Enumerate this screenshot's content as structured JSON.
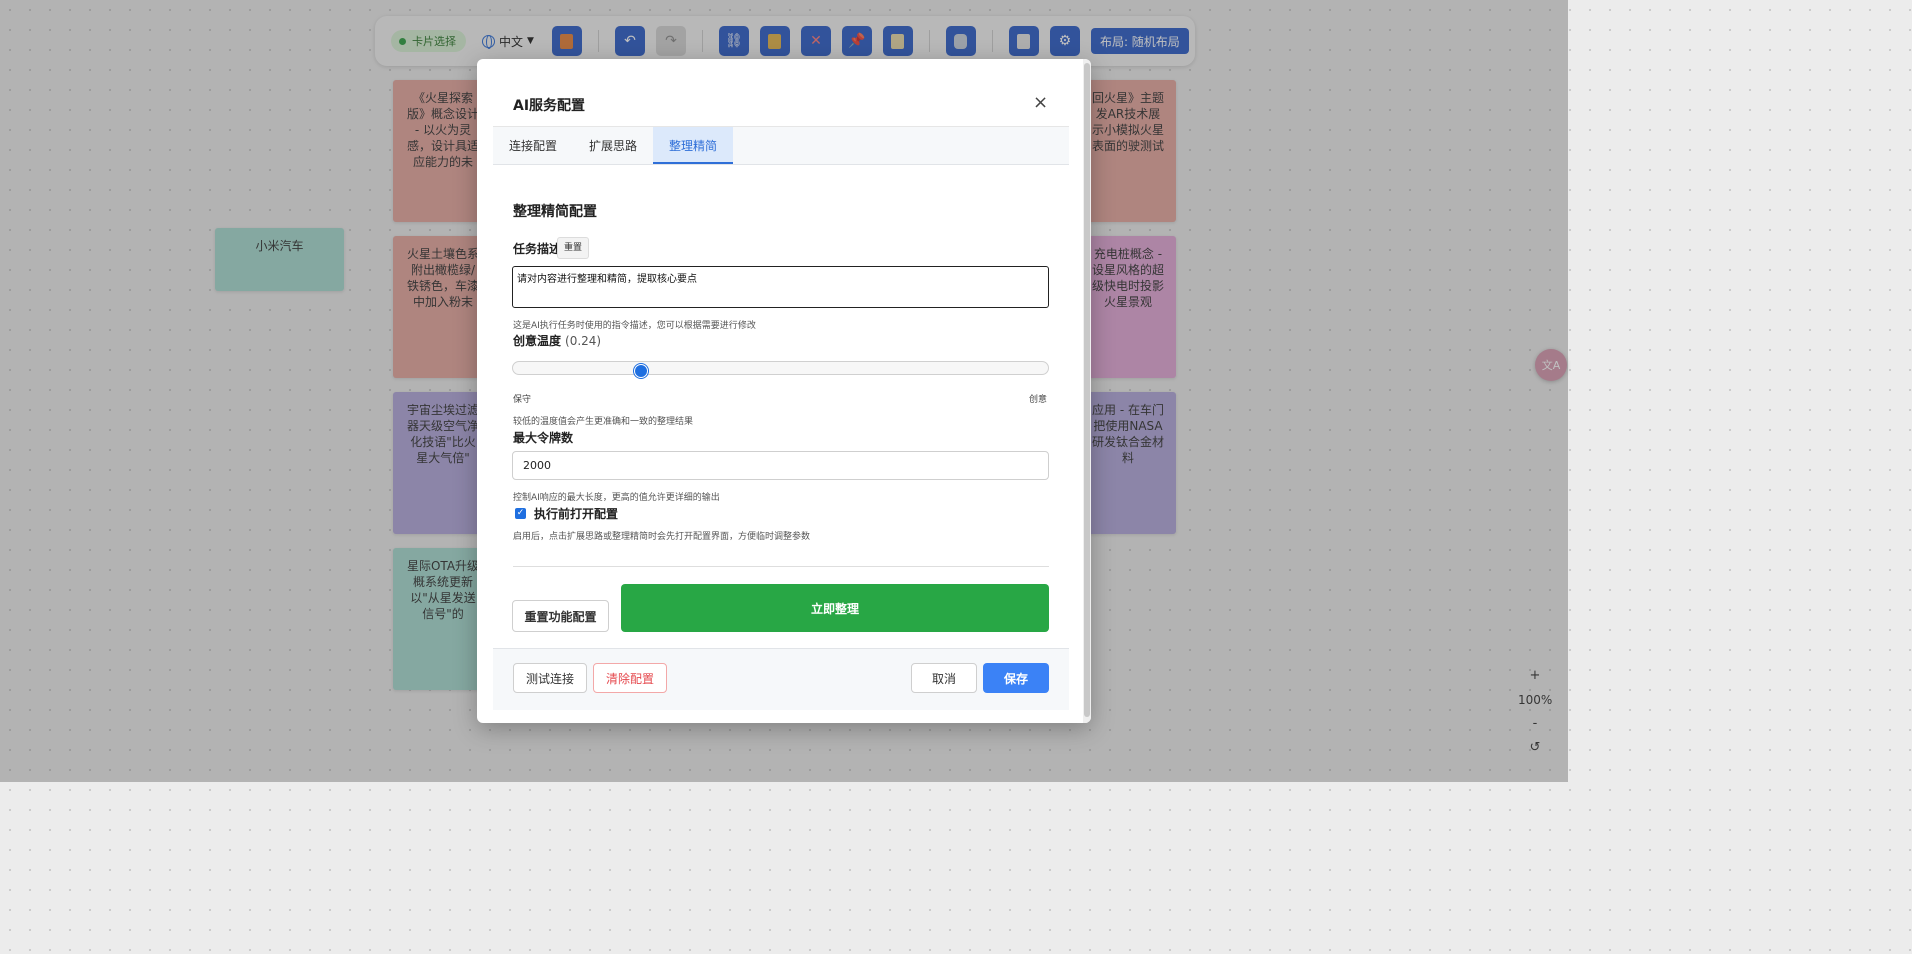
{
  "toolbar": {
    "mode_badge": "卡片选择",
    "language": "中文",
    "layout_button": "布局: 随机布局"
  },
  "cards": [
    {
      "text": "《火星探索版》概念设计 - 以火为灵感，设计具适应能力的未",
      "color": "#e6a8a0"
    },
    {
      "text": "小米汽车",
      "color": "#a8dcd2"
    },
    {
      "text": "火星土壤色系附出橄榄绿/铁锈色，车漆中加入粉末",
      "color": "#e6a8a0"
    },
    {
      "text": "宇宙尘埃过滤器天级空气净化技语\"比火星大气倍\"",
      "color": "#b3a9dc"
    },
    {
      "text": "星际OTA升级概系统更新以\"从星发送信号\"的",
      "color": "#a8dcd2"
    },
    {
      "text": "回火星》主题发AR技术展示小模拟火星表面的驶测试",
      "color": "#e6a8a0"
    },
    {
      "text": "充电桩概念 - 设星风格的超级快电时投影火星景观",
      "color": "#e3a8d8"
    },
    {
      "text": "应用 - 在车门把使用NASA研发钛合金材料",
      "color": "#b3a9dc"
    }
  ],
  "zoom": {
    "plus": "+",
    "level": "100%",
    "minus": "-",
    "reset": "↺"
  },
  "modal": {
    "title": "AI服务配置",
    "close": "×",
    "tabs": [
      {
        "label": "连接配置"
      },
      {
        "label": "扩展思路"
      },
      {
        "label": "整理精简"
      }
    ],
    "section_title": "整理精简配置",
    "task": {
      "label": "任务描述",
      "reset_label": "重置",
      "value": "请对内容进行整理和精简，提取核心要点",
      "hint": "这是AI执行任务时使用的指令描述，您可以根据需要进行修改"
    },
    "temperature": {
      "label": "创意温度",
      "value_text": "(0.24)",
      "value": 0.24,
      "min_label": "保守",
      "max_label": "创意",
      "hint": "较低的温度值会产生更准确和一致的整理结果"
    },
    "max_tokens": {
      "label": "最大令牌数",
      "value": "2000",
      "hint": "控制AI响应的最大长度，更高的值允许更详细的输出"
    },
    "open_before": {
      "label": "执行前打开配置",
      "checked": true,
      "hint": "启用后，点击扩展思路或整理精简时会先打开配置界面，方便临时调整参数"
    },
    "reset_config_label": "重置功能配置",
    "run_now_label": "立即整理",
    "footer": {
      "test_label": "测试连接",
      "clear_label": "清除配置",
      "cancel_label": "取消",
      "save_label": "保存"
    }
  },
  "colors": {
    "primary": "#3b82f6",
    "toolbar_button": "#2f5fc9",
    "success": "#28a745",
    "danger": "#e5484d"
  }
}
